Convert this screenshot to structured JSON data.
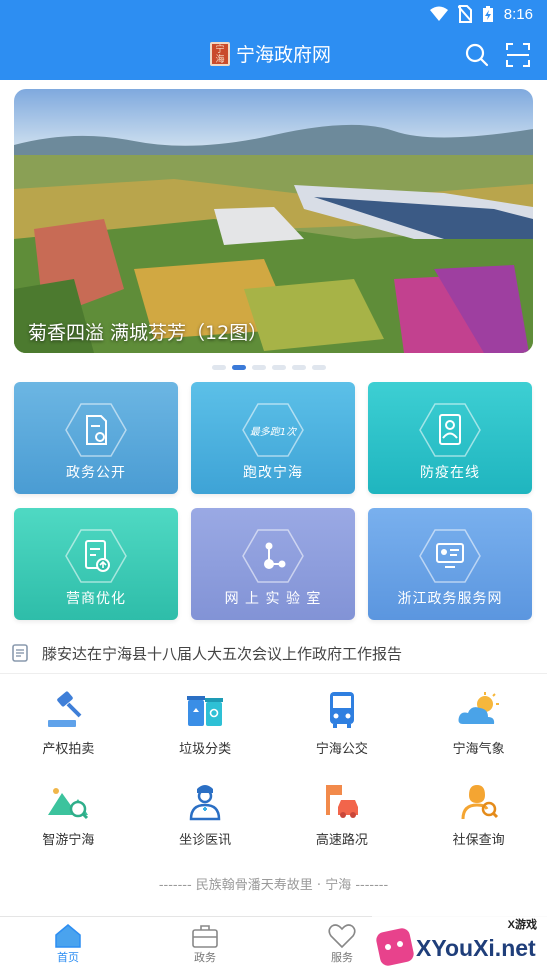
{
  "status_bar": {
    "time": "8:16",
    "icons": [
      "wifi-icon",
      "no-sim-icon",
      "battery-icon"
    ]
  },
  "header": {
    "logo_text": "宁海",
    "title": "宁海政府网",
    "icons": [
      "search-icon",
      "scan-icon"
    ]
  },
  "banner": {
    "caption": "菊香四溢 满城芬芳（12图）",
    "page_count": 6,
    "active_page": 1
  },
  "tiles": [
    {
      "label": "政务公开",
      "icon": "document-icon",
      "color": "#5aa9d9"
    },
    {
      "label": "跑改宁海",
      "icon": "once-at-most-icon",
      "color": "#4fb4df"
    },
    {
      "label": "防疫在线",
      "icon": "profile-icon",
      "color": "#2ec2c9"
    },
    {
      "label": "营商优化",
      "icon": "upload-doc-icon",
      "color": "#3ccdb9"
    },
    {
      "label": "网上实验室",
      "icon": "network-nodes-icon",
      "color": "#8f9fdd"
    },
    {
      "label": "浙江政务服务网",
      "icon": "id-card-icon",
      "color": "#6ba4e8"
    }
  ],
  "tile_label_lab": "网 上 实 验 室",
  "notice": {
    "text": "滕安达在宁海县十八届人大五次会议上作政府工作报告"
  },
  "services": [
    {
      "label": "产权拍卖",
      "icon": "gavel-icon"
    },
    {
      "label": "垃圾分类",
      "icon": "trash-bins-icon"
    },
    {
      "label": "宁海公交",
      "icon": "bus-icon"
    },
    {
      "label": "宁海气象",
      "icon": "weather-icon"
    },
    {
      "label": "智游宁海",
      "icon": "travel-icon"
    },
    {
      "label": "坐诊医讯",
      "icon": "doctor-icon"
    },
    {
      "label": "高速路况",
      "icon": "highway-icon"
    },
    {
      "label": "社保查询",
      "icon": "social-security-icon"
    }
  ],
  "slogan": "------- 民族翰骨潘天寿故里 · 宁海 -------",
  "tabbar": [
    {
      "label": "首页",
      "icon": "home-icon",
      "active": true
    },
    {
      "label": "政务",
      "icon": "briefcase-icon",
      "active": false
    },
    {
      "label": "服务",
      "icon": "heart-icon",
      "active": false
    }
  ],
  "watermark": {
    "text": "XYouXi.net",
    "tag": "X游戏"
  },
  "colors": {
    "primary": "#2d8ef2",
    "active_dot": "#3b7ad8"
  }
}
